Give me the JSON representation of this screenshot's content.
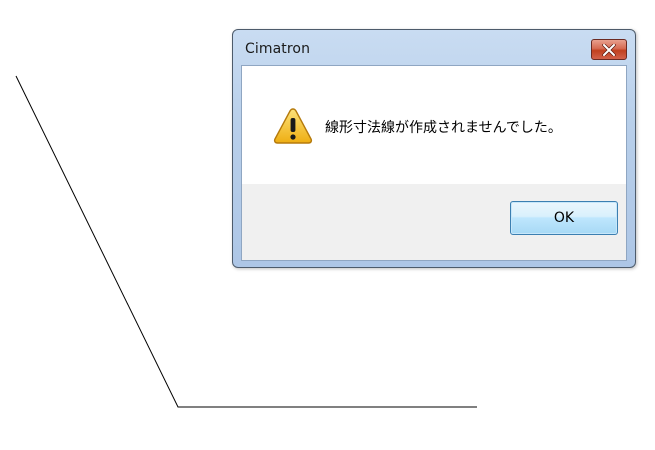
{
  "dialog": {
    "title": "Cimatron",
    "message": "線形寸法線が作成されませんでした。",
    "ok_label": "OK",
    "close_icon": "close-icon",
    "warning_icon": "warning-icon"
  },
  "colors": {
    "close_button": "#d2614a",
    "ok_button_border": "#3c7fb1",
    "footer_background": "#f0f0f0",
    "warning_yellow": "#f6c631"
  }
}
